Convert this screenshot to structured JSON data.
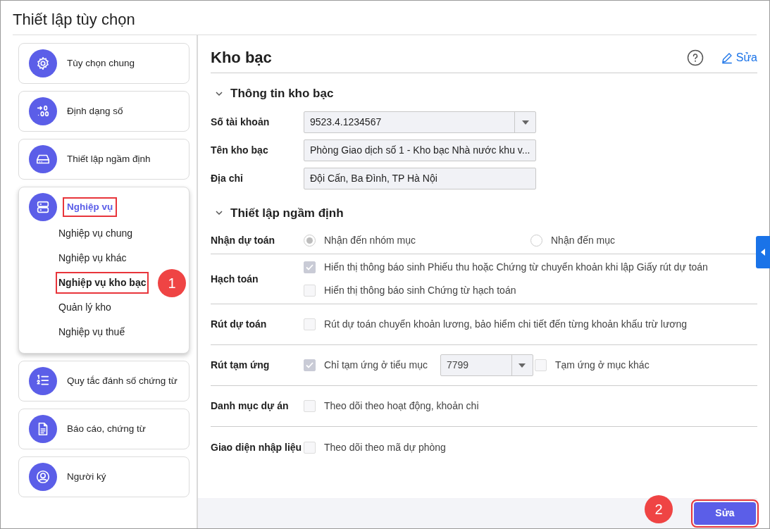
{
  "window": {
    "title": "Thiết lập tùy chọn"
  },
  "sidebar": {
    "items": [
      {
        "kind": "gear",
        "label": "Tùy chọn chung",
        "expanded": false,
        "selected": false,
        "highlighted": false
      },
      {
        "kind": "number-format",
        "label": "Định dạng số",
        "expanded": false,
        "selected": false,
        "highlighted": false
      },
      {
        "kind": "drive",
        "label": "Thiết lập ngầm định",
        "expanded": false,
        "selected": false,
        "highlighted": false
      },
      {
        "kind": "server",
        "label": "Nghiệp vụ",
        "expanded": true,
        "selected": true,
        "highlighted": true,
        "children": [
          {
            "label": "Nghiệp vụ chung",
            "selected": false,
            "highlighted": false
          },
          {
            "label": "Nghiệp vụ khác",
            "selected": false,
            "highlighted": false
          },
          {
            "label": "Nghiệp vụ kho bạc",
            "selected": true,
            "highlighted": true,
            "callout": "1"
          },
          {
            "label": "Quản lý kho",
            "selected": false,
            "highlighted": false
          },
          {
            "label": "Nghiệp vụ thuế",
            "selected": false,
            "highlighted": false
          }
        ]
      },
      {
        "kind": "numbered-list",
        "label": "Quy tắc đánh số chứng từ",
        "expanded": false,
        "selected": false,
        "highlighted": false
      },
      {
        "kind": "document",
        "label": "Báo cáo, chứng từ",
        "expanded": false,
        "selected": false,
        "highlighted": false
      },
      {
        "kind": "person",
        "label": "Người ký",
        "expanded": false,
        "selected": false,
        "highlighted": false
      }
    ]
  },
  "content": {
    "title": "Kho bạc",
    "edit_link": "Sửa",
    "info_section": {
      "title": "Thông tin kho bạc",
      "expanded": true,
      "fields": [
        {
          "label": "Số tài khoản",
          "kind": "select",
          "value": "9523.4.1234567"
        },
        {
          "label": "Tên kho bạc",
          "kind": "text",
          "value": "Phòng Giao dịch số 1 - Kho bạc Nhà nước khu v..."
        },
        {
          "label": "Địa chỉ",
          "kind": "text",
          "value": "Đội Cấn, Ba Đình, TP Hà Nội"
        }
      ]
    },
    "defaults_section": {
      "title": "Thiết lập ngầm định",
      "expanded": true,
      "rows": [
        {
          "label": "Nhận dự toán",
          "kind": "radio",
          "options": [
            {
              "label": "Nhận đến nhóm mục",
              "selected": true
            },
            {
              "label": "Nhận đến mục",
              "selected": false
            }
          ]
        },
        {
          "label": "Hạch toán",
          "kind": "checks",
          "options": [
            {
              "label": "Hiển thị thông báo sinh Phiếu thu hoặc Chứng từ chuyển khoản khi lập Giấy rút dự toán",
              "checked": true
            },
            {
              "label": "Hiển thị thông báo sinh Chứng từ hạch toán",
              "checked": false
            }
          ]
        },
        {
          "label": "Rút dự toán",
          "kind": "checks",
          "options": [
            {
              "label": "Rút dự toán chuyển khoản lương, bảo hiểm chi tiết đến từng khoản khấu trừ lương",
              "checked": false
            }
          ]
        },
        {
          "label": "Rút tạm ứng",
          "kind": "check_select",
          "options": [
            {
              "label": "Chỉ tạm ứng ở tiểu mục",
              "checked": true,
              "select_value": "7799"
            },
            {
              "label": "Tạm ứng ở mục khác",
              "checked": false
            }
          ]
        },
        {
          "label": "Danh mục dự án",
          "kind": "checks",
          "options": [
            {
              "label": "Theo dõi theo hoạt động, khoản chi",
              "checked": false
            }
          ]
        },
        {
          "label": "Giao diện nhập liệu",
          "kind": "checks",
          "options": [
            {
              "label": "Theo dõi theo mã dự phòng",
              "checked": false
            }
          ]
        }
      ]
    }
  },
  "footer": {
    "button": "Sửa",
    "highlighted": true,
    "callout": "2"
  }
}
